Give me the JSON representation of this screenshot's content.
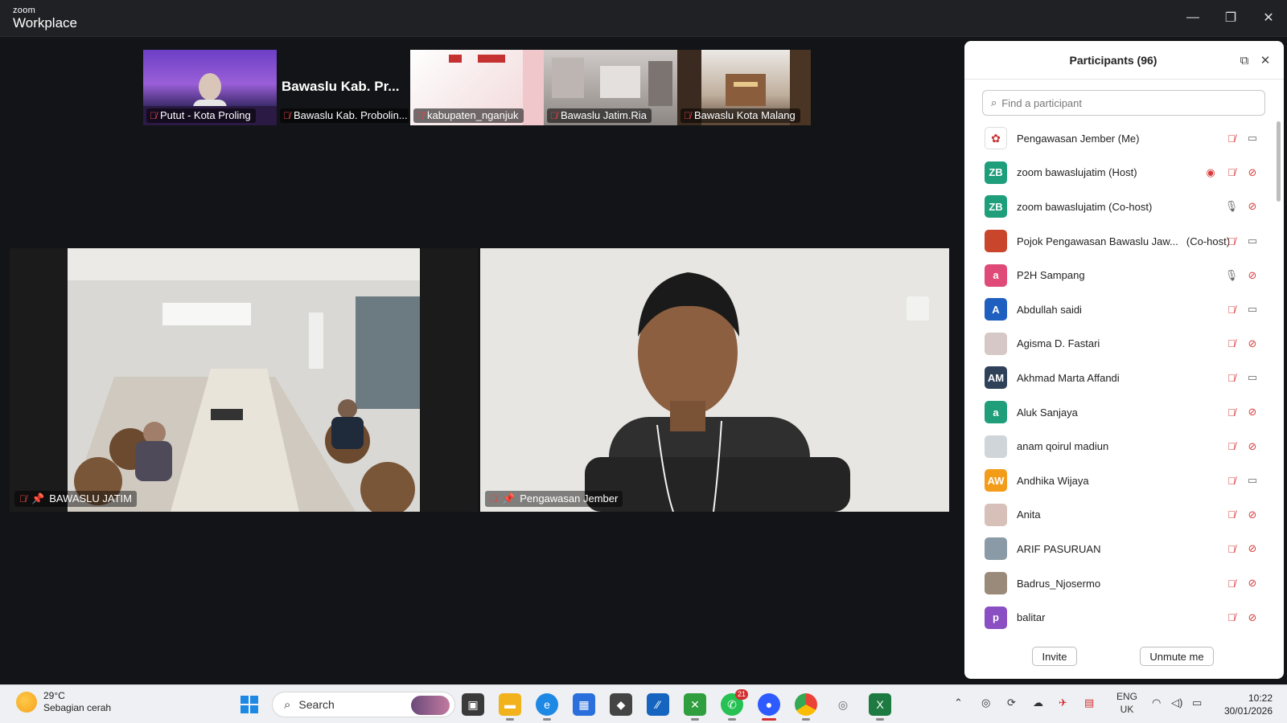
{
  "window": {
    "brand_small": "zoom",
    "brand_big": "Workplace",
    "minimize": "—",
    "restore": "❐",
    "close": "✕"
  },
  "strip": [
    {
      "label": "Putut - Kota Proling",
      "bg": "#5a3aa0"
    },
    {
      "label": "Bawaslu Kab. Probolin...",
      "overlay": "Bawaslu Kab. Pr...",
      "bg": "#121417"
    },
    {
      "label": "kabupaten_nganjuk",
      "bg": "#f7efef"
    },
    {
      "label": "Bawaslu Jatim.Ria",
      "bg": "#b7b2b0"
    },
    {
      "label": "Bawaslu  Kota Malang",
      "bg": "#6d5a48"
    }
  ],
  "tiles": {
    "left_label": "BAWASLU JATIM",
    "right_label": "Pengawasan Jember"
  },
  "panel": {
    "title": "Participants (96)",
    "search_placeholder": "Find a participant",
    "invite": "Invite",
    "unmute": "Unmute me",
    "participants": [
      {
        "name": "Pengawasan Jember (Me)",
        "avatar": "",
        "color": "#ffffff",
        "mic": "off",
        "video": "on"
      },
      {
        "name": "zoom bawaslujatim (Host)",
        "avatar": "ZB",
        "color": "#1e9e7a",
        "mic": "off",
        "video": "off",
        "rec": true
      },
      {
        "name": "zoom bawaslujatim (Co-host)",
        "avatar": "ZB",
        "color": "#1e9e7a",
        "mic": "on",
        "video": "off"
      },
      {
        "name": "Pojok Pengawasan Bawaslu Jaw...",
        "suffix": "(Co-host)",
        "avatar": "",
        "color": "#c9452b",
        "mic": "off",
        "video": "on"
      },
      {
        "name": "P2H Sampang",
        "avatar": "a",
        "color": "#e04a78",
        "mic": "on",
        "video": "off"
      },
      {
        "name": "Abdullah saidi",
        "avatar": "A",
        "color": "#1f5fbf",
        "mic": "off",
        "video": "on"
      },
      {
        "name": "Agisma D. Fastari",
        "avatar": "",
        "color": "#d7c8c8",
        "mic": "off",
        "video": "off"
      },
      {
        "name": "Akhmad Marta Affandi",
        "avatar": "AM",
        "color": "#2f4159",
        "mic": "off",
        "video": "on"
      },
      {
        "name": "Aluk Sanjaya",
        "avatar": "a",
        "color": "#1e9e7a",
        "mic": "off",
        "video": "off"
      },
      {
        "name": "anam qoirul madiun",
        "avatar": "",
        "color": "#cfd5d9",
        "mic": "off",
        "video": "off"
      },
      {
        "name": "Andhika Wijaya",
        "avatar": "AW",
        "color": "#f39c1a",
        "mic": "off",
        "video": "on"
      },
      {
        "name": "Anita",
        "avatar": "",
        "color": "#d6c0b8",
        "mic": "off",
        "video": "off"
      },
      {
        "name": "ARIF PASURUAN",
        "avatar": "",
        "color": "#8a9aa6",
        "mic": "off",
        "video": "off"
      },
      {
        "name": "Badrus_Njosermo",
        "avatar": "",
        "color": "#9a8a7a",
        "mic": "off",
        "video": "off"
      },
      {
        "name": "balitar",
        "avatar": "p",
        "color": "#8a4fc2",
        "mic": "off",
        "video": "off"
      }
    ]
  },
  "taskbar": {
    "temp": "29°C",
    "weather": "Sebagian cerah",
    "search": "Search",
    "lang_top": "ENG",
    "lang_bottom": "UK",
    "time": "10:22",
    "date": "30/01/2026",
    "whatsapp_badge": "21"
  }
}
